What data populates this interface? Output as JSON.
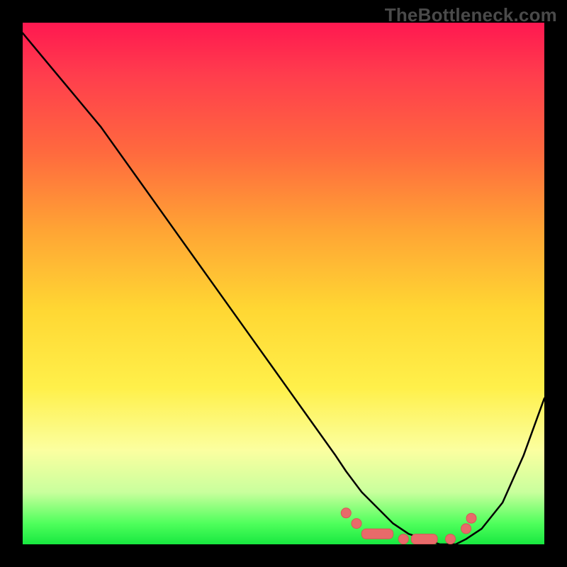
{
  "watermark": "TheBottleneck.com",
  "colors": {
    "frame": "#000000",
    "curve": "#000000",
    "marker": "#e86a6a",
    "gradient_stops": [
      "#ff1850",
      "#ff6a3e",
      "#ffd733",
      "#fbffa0",
      "#18e840"
    ]
  },
  "chart_data": {
    "type": "line",
    "title": "",
    "xlabel": "",
    "ylabel": "",
    "xlim": [
      0,
      100
    ],
    "ylim": [
      0,
      100
    ],
    "grid": false,
    "series": [
      {
        "name": "bottleneck-curve",
        "x": [
          0,
          5,
          10,
          15,
          20,
          25,
          30,
          35,
          40,
          45,
          50,
          55,
          60,
          62,
          65,
          68,
          71,
          74,
          77,
          80,
          83,
          85,
          88,
          92,
          96,
          100
        ],
        "y": [
          98,
          92,
          86,
          80,
          73,
          66,
          59,
          52,
          45,
          38,
          31,
          24,
          17,
          14,
          10,
          7,
          4,
          2,
          1,
          0,
          0,
          1,
          3,
          8,
          17,
          28
        ]
      }
    ],
    "markers": [
      {
        "shape": "dot",
        "x": 62,
        "y": 6
      },
      {
        "shape": "dot",
        "x": 64,
        "y": 4
      },
      {
        "shape": "lozenge",
        "x": 68,
        "y": 2,
        "w": 6
      },
      {
        "shape": "dot",
        "x": 73,
        "y": 1
      },
      {
        "shape": "lozenge",
        "x": 77,
        "y": 1,
        "w": 5
      },
      {
        "shape": "dot",
        "x": 82,
        "y": 1
      },
      {
        "shape": "dot",
        "x": 85,
        "y": 3
      },
      {
        "shape": "dot",
        "x": 86,
        "y": 5
      }
    ]
  }
}
